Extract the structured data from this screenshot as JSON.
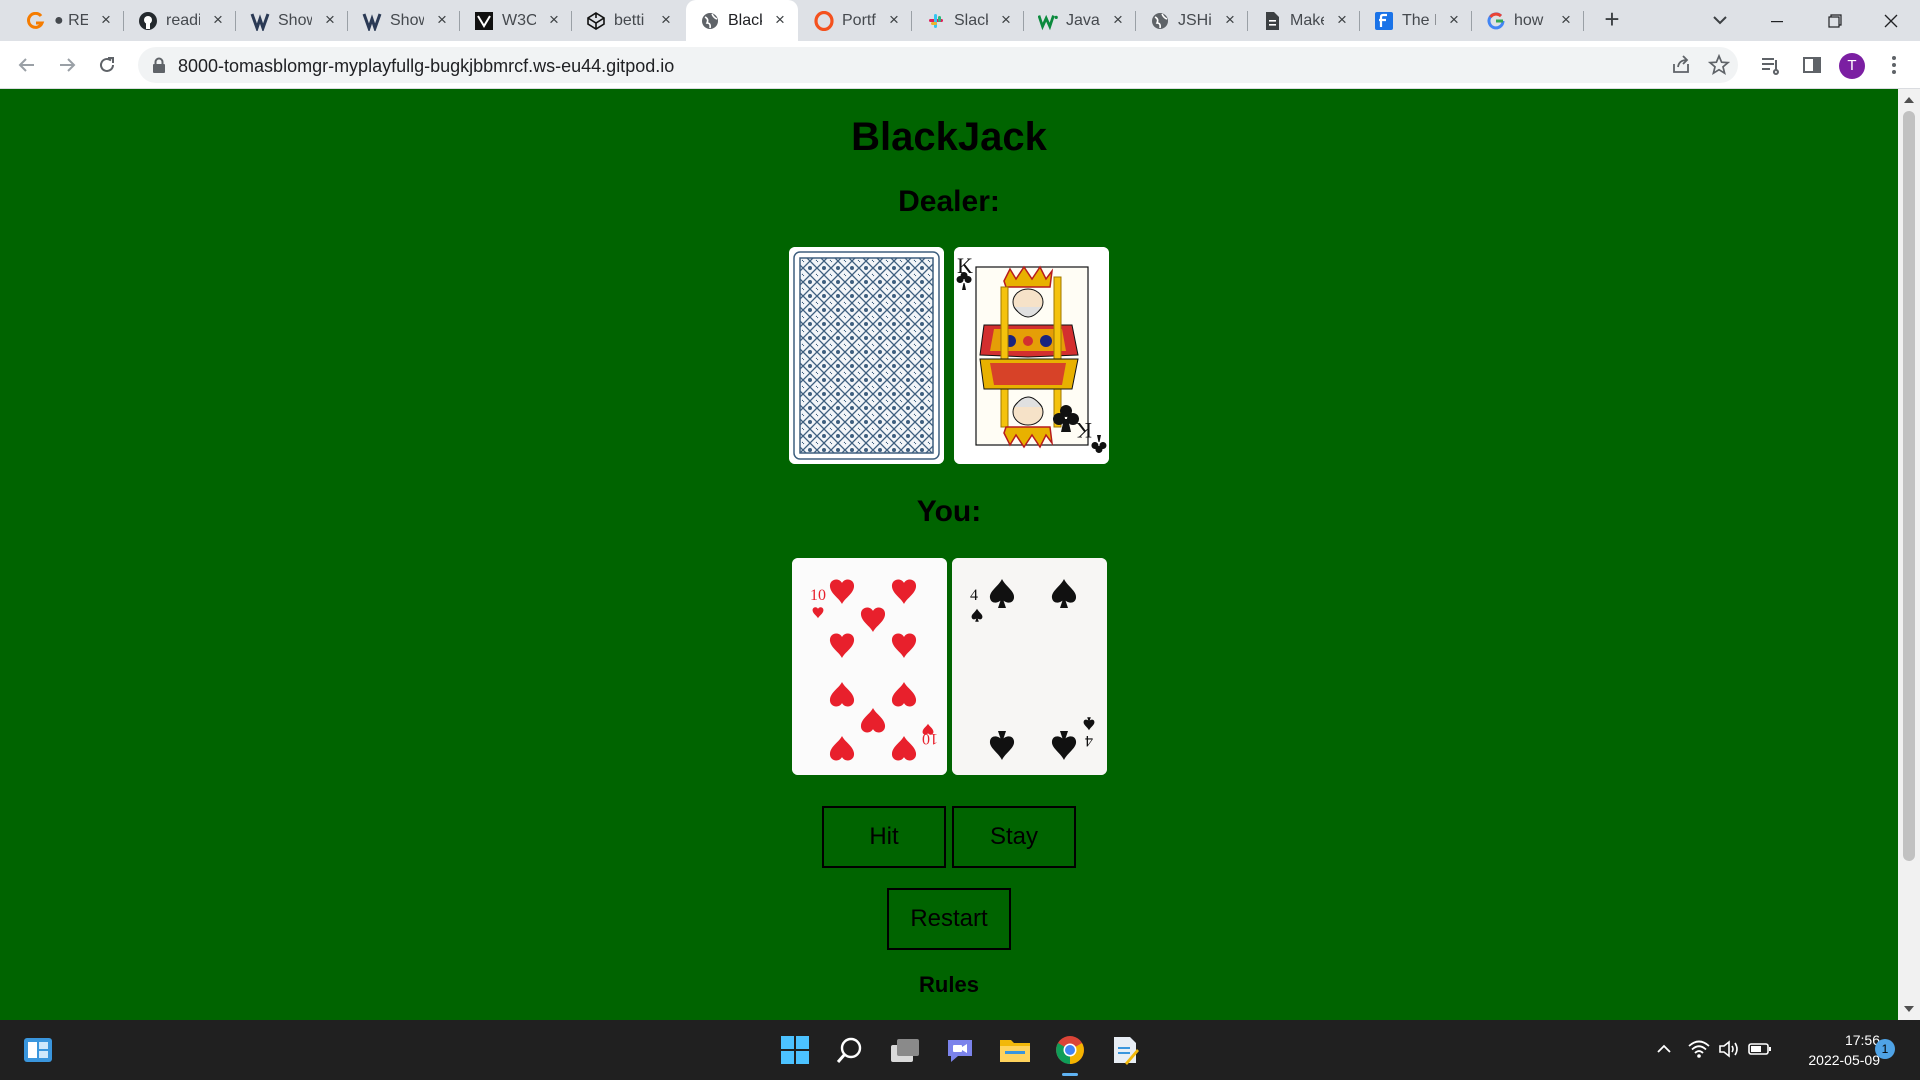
{
  "browser": {
    "tabs": [
      {
        "label": "● RE",
        "icon": "g-orange-icon"
      },
      {
        "label": "readi",
        "icon": "github-icon"
      },
      {
        "label": "Show",
        "icon": "bv-icon"
      },
      {
        "label": "Show",
        "icon": "bv-icon"
      },
      {
        "label": "W3C",
        "icon": "w3c-icon"
      },
      {
        "label": "betti",
        "icon": "codepen-icon"
      },
      {
        "label": "Black",
        "icon": "globe-icon",
        "active": true
      },
      {
        "label": "Portf",
        "icon": "opera-icon"
      },
      {
        "label": "Slack",
        "icon": "slack-icon"
      },
      {
        "label": "Javas",
        "icon": "w-green-icon"
      },
      {
        "label": "JSHin",
        "icon": "globe-icon"
      },
      {
        "label": "Make",
        "icon": "doc-icon"
      },
      {
        "label": "The I",
        "icon": "f-blue-icon"
      },
      {
        "label": "how",
        "icon": "google-icon"
      }
    ],
    "url": "8000-tomasblomgr-myplayfullg-bugkjbbmrcf.ws-eu44.gitpod.io",
    "profile_initial": "T"
  },
  "game": {
    "title": "BlackJack",
    "dealer_heading": "Dealer:",
    "player_heading": "You:",
    "dealer_cards": [
      {
        "face": "back"
      },
      {
        "rank": "K",
        "suit": "clubs"
      }
    ],
    "player_cards": [
      {
        "rank": "10",
        "suit": "hearts"
      },
      {
        "rank": "4",
        "suit": "spades"
      }
    ],
    "hit_label": "Hit",
    "stay_label": "Stay",
    "restart_label": "Restart",
    "rules_label": "Rules",
    "colors": {
      "table": "#006400",
      "hearts": "#e8202c",
      "spades": "#111111"
    }
  },
  "taskbar": {
    "time": "17:56",
    "date": "2022-05-09",
    "notification_count": "1"
  }
}
